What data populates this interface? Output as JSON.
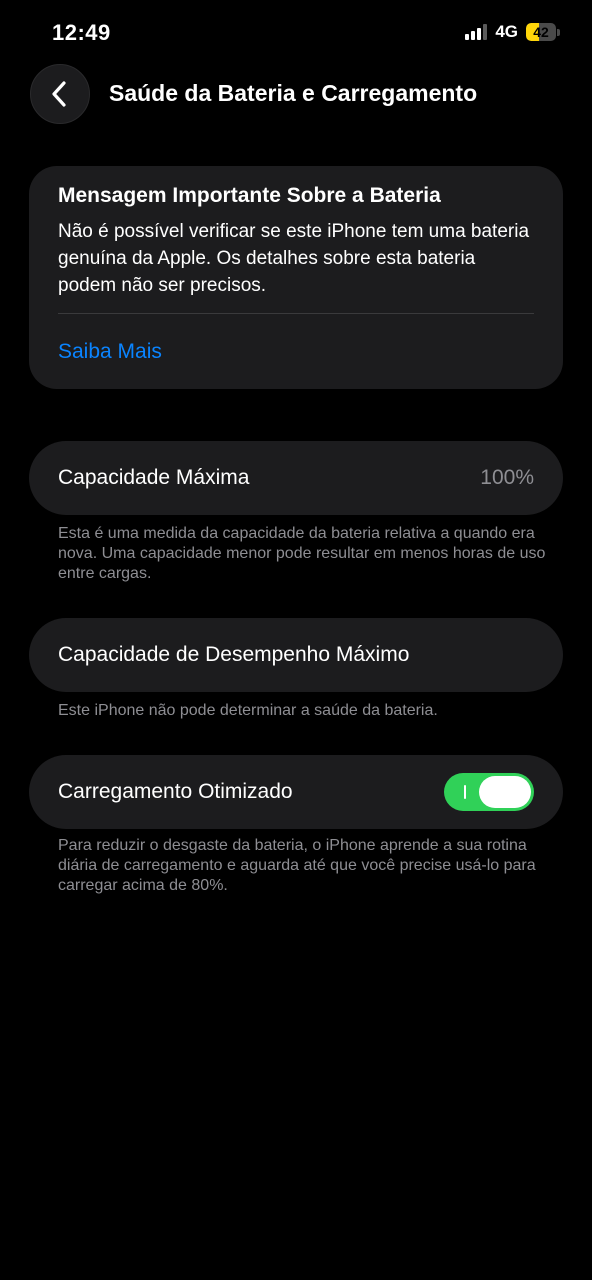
{
  "status_bar": {
    "time": "12:49",
    "network": "4G",
    "battery_level": "42",
    "battery_fraction": 0.42,
    "battery_color": "#ffd60a",
    "signal_bars_active": 3
  },
  "nav": {
    "back_icon": "chevron-left-icon",
    "title": "Saúde da Bateria e Carregamento"
  },
  "message_card": {
    "title": "Mensagem Importante Sobre a Bateria",
    "body": "Não é possível verificar se este iPhone tem uma bateria genuína da Apple. Os detalhes sobre esta bateria podem não ser precisos.",
    "link_label": "Saiba Mais",
    "link_color": "#0a84ff"
  },
  "max_capacity": {
    "label": "Capacidade Máxima",
    "value": "100%",
    "footnote": "Esta é uma medida da capacidade da bateria relativa a quando era nova. Uma capacidade menor pode resultar em menos horas de uso entre cargas."
  },
  "peak_performance": {
    "label": "Capacidade de Desempenho Máximo",
    "footnote": "Este iPhone não pode determinar a saúde da bateria."
  },
  "optimized_charging": {
    "label": "Carregamento Otimizado",
    "enabled": true,
    "toggle_color": "#30d158",
    "footnote": "Para reduzir o desgaste da bateria, o iPhone aprende a sua rotina diária de carregamento e aguarda até que você precise usá-lo para carregar acima de 80%."
  }
}
